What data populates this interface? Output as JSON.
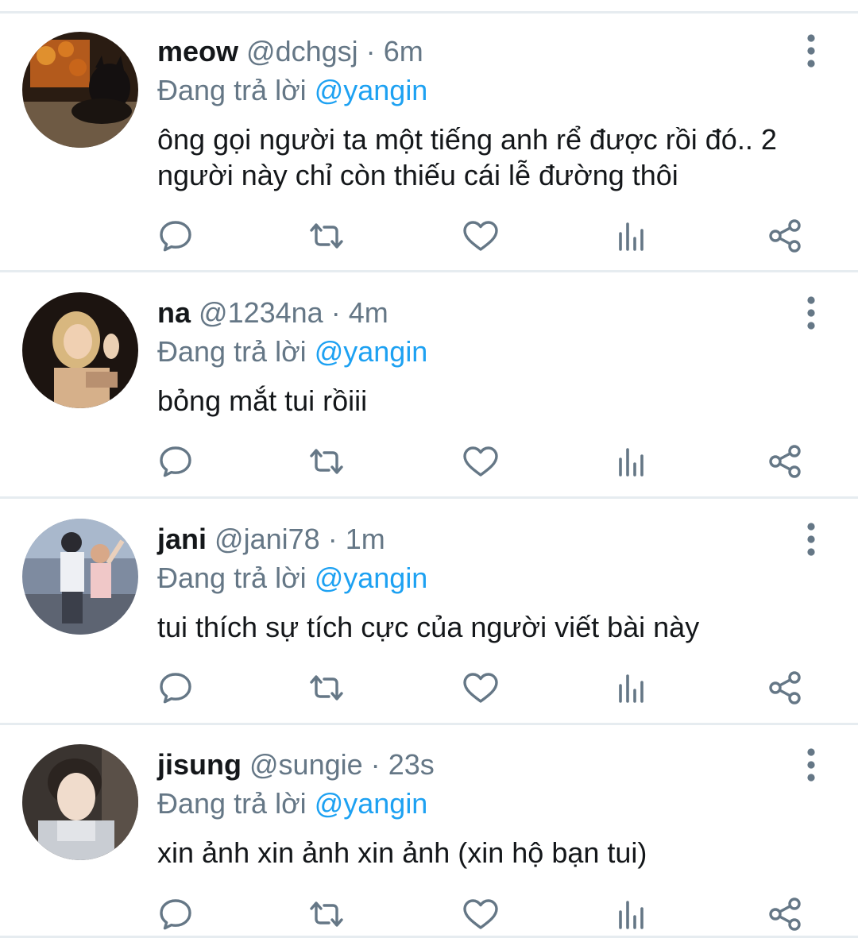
{
  "replies": [
    {
      "name": "meow",
      "handle": "@dchgsj",
      "separator": "·",
      "time": "6m",
      "reply_prefix": "Đang trả lời",
      "reply_to": "@yangin",
      "text_line1": "ông gọi người ta một tiếng anh rể được rồi đó.. 2",
      "text_line2": "người này chỉ còn thiếu cái lễ đường thôi"
    },
    {
      "name": "na",
      "handle": "@1234na",
      "separator": "·",
      "time": "4m",
      "reply_prefix": "Đang trả lời",
      "reply_to": "@yangin",
      "text_line1": "bỏng mắt tui rồiii"
    },
    {
      "name": "jani",
      "handle": "@jani78",
      "separator": "·",
      "time": "1m",
      "reply_prefix": "Đang trả lời",
      "reply_to": "@yangin",
      "text_line1": "tui thích sự tích cực của người viết bài này"
    },
    {
      "name": "jisung",
      "handle": "@sungie",
      "separator": "·",
      "time": "23s",
      "reply_prefix": "Đang trả lời",
      "reply_to": "@yangin",
      "text_line1": "xin ảnh xin ảnh xin ảnh (xin hộ bạn tui)"
    }
  ],
  "icons": {
    "reply": "comment-icon",
    "retweet": "retweet-icon",
    "like": "heart-icon",
    "analytics": "analytics-icon",
    "share": "share-icon",
    "more": "more-vertical-icon"
  },
  "colors": {
    "text": "#14171a",
    "secondary": "#657786",
    "mention": "#1da1f2",
    "divider": "#e6ecf0"
  }
}
